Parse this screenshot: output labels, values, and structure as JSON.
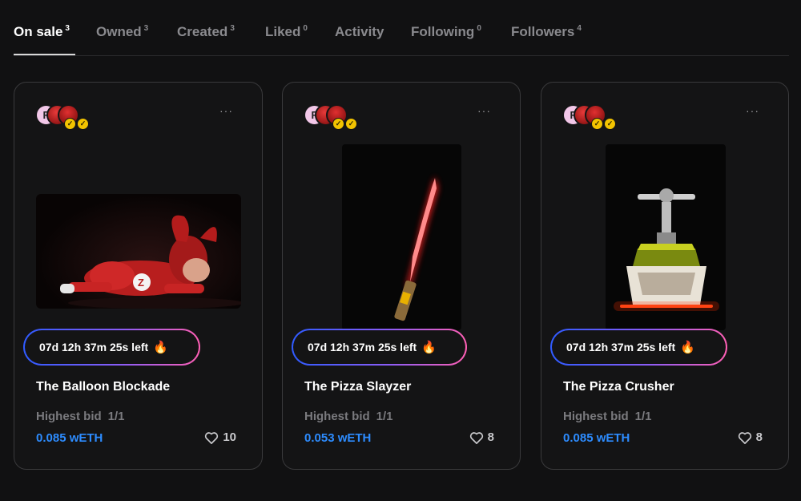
{
  "tabs": [
    {
      "label": "On sale",
      "count": "3"
    },
    {
      "label": "Owned",
      "count": "3"
    },
    {
      "label": "Created",
      "count": "3"
    },
    {
      "label": "Liked",
      "count": "0"
    },
    {
      "label": "Activity",
      "count": ""
    },
    {
      "label": "Following",
      "count": "0"
    },
    {
      "label": "Followers",
      "count": "4"
    }
  ],
  "active_tab": "On sale",
  "cards": [
    {
      "title": "The Balloon Blockade",
      "timer": "07d  12h  37m  25s  left",
      "bid_label": "Highest bid",
      "bid_count": "1/1",
      "price": "0.085 wETH",
      "likes": "10",
      "media_icon": "mascot-figure-image"
    },
    {
      "title": "The Pizza Slayzer",
      "timer": "07d  12h  37m  25s  left",
      "bid_label": "Highest bid",
      "bid_count": "1/1",
      "price": "0.053 wETH",
      "likes": "8",
      "media_icon": "glowing-sword-image"
    },
    {
      "title": "The Pizza Crusher",
      "timer": "07d  12h  37m  25s  left",
      "bid_label": "Highest bid",
      "bid_count": "1/1",
      "price": "0.085 wETH",
      "likes": "8",
      "media_icon": "pizza-press-image"
    }
  ],
  "avatar_letter": "F",
  "more_label": "···",
  "fire_icon": "🔥",
  "colors": {
    "background": "#111112",
    "price_blue": "#2d8cff",
    "timer_gradient_start": "#2f5bff",
    "timer_gradient_end": "#ff5fb4",
    "verified_badge": "#f2c300"
  }
}
